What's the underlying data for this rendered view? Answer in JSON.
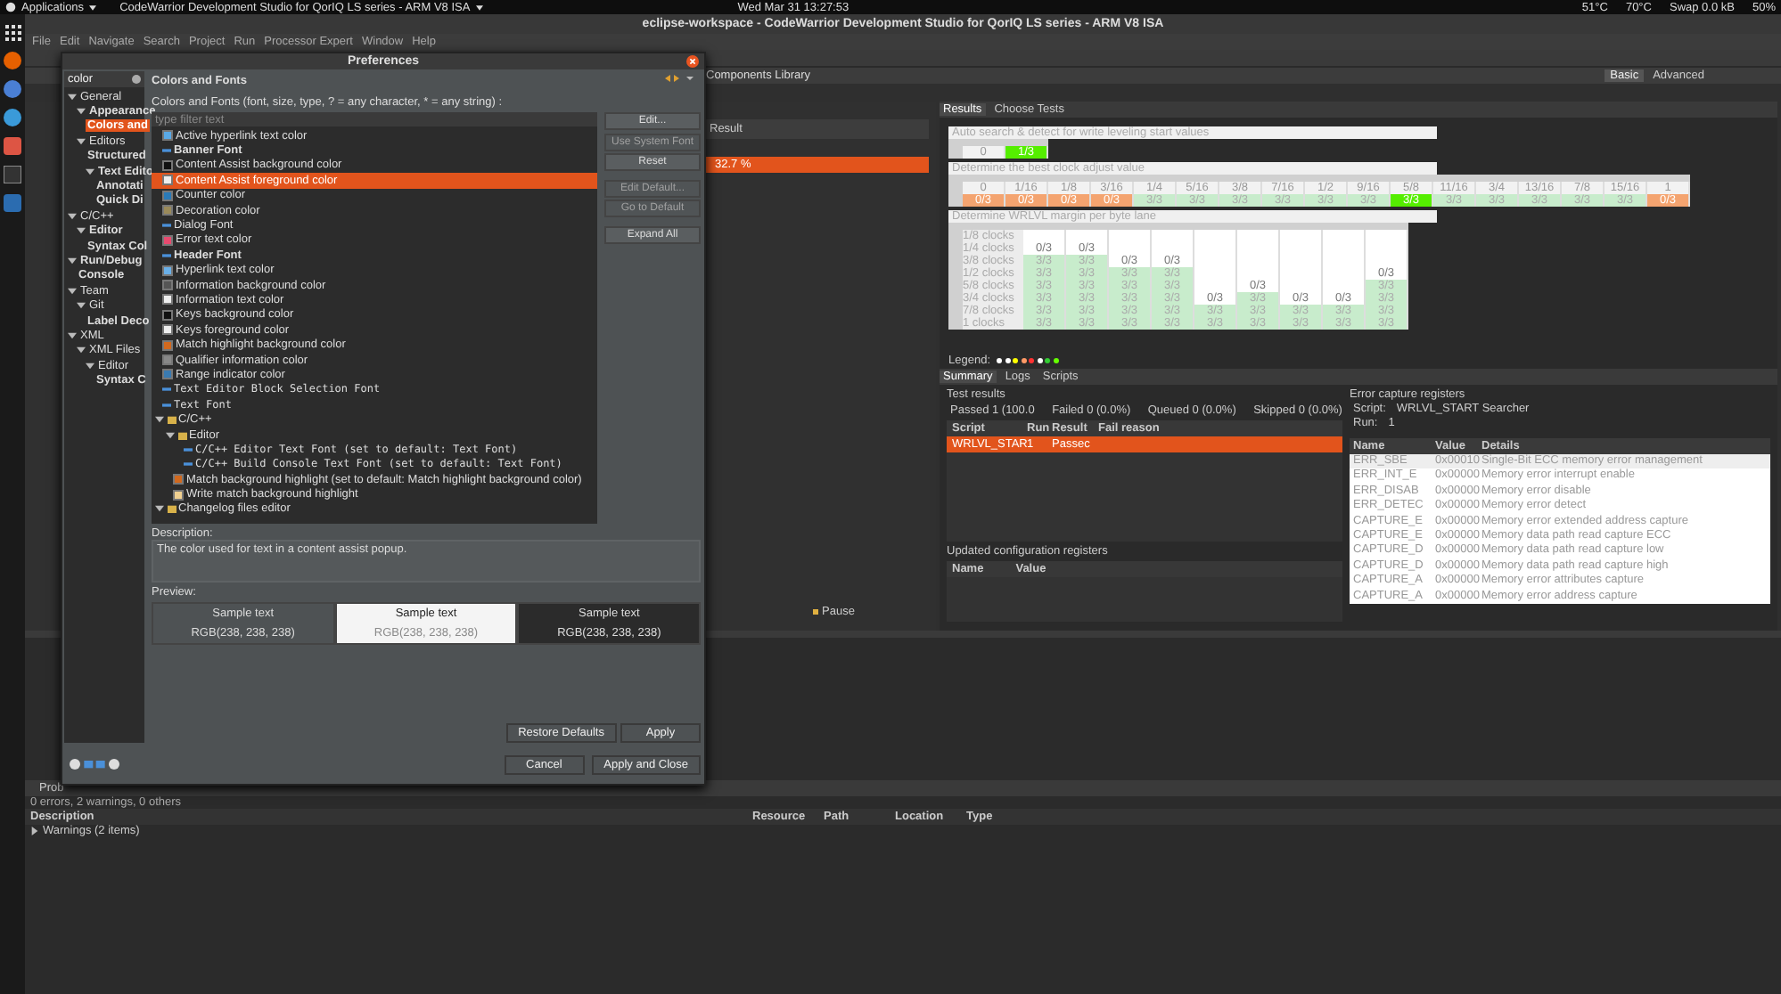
{
  "top_bar": {
    "applications": "Applications",
    "app_menu": "CodeWarrior Development Studio for QorIQ LS series - ARM V8 ISA",
    "clock": "Wed Mar 31  13:27:53",
    "status": [
      "51°C",
      "70°C",
      "Swap 0.0 kB",
      "50%"
    ]
  },
  "window": {
    "title": "eclipse-workspace - CodeWarrior Development Studio for QorIQ LS series - ARM V8 ISA"
  },
  "menu": [
    "File",
    "Edit",
    "Navigate",
    "Search",
    "Project",
    "Run",
    "Processor Expert",
    "Window",
    "Help"
  ],
  "perspective": {
    "tab": "Components Library",
    "buttons": [
      {
        "label": "Basic",
        "selected": true
      },
      {
        "label": "Advanced",
        "selected": false
      }
    ]
  },
  "editor": {
    "column": "Result",
    "value": "32.7 %"
  },
  "results": {
    "tabs": [
      {
        "label": "Results",
        "selected": true
      },
      {
        "label": "Choose Tests",
        "selected": false
      }
    ],
    "tables": [
      {
        "title": "Auto search & detect for write leveling start values",
        "rows": [
          {
            "cells": [
              {
                "text": "0",
                "kind": "plain"
              },
              {
                "text": "1/3",
                "kind": "best"
              }
            ]
          }
        ]
      },
      {
        "title": "Determine the best clock adjust value",
        "header": [
          "0",
          "1/16",
          "1/8",
          "3/16",
          "1/4",
          "5/16",
          "3/8",
          "7/16",
          "1/2",
          "9/16",
          "5/8",
          "11/16",
          "3/4",
          "13/16",
          "7/8",
          "15/16",
          "1"
        ],
        "rows": [
          {
            "cells": [
              {
                "text": "0/3",
                "kind": "fail"
              },
              {
                "text": "0/3",
                "kind": "fail"
              },
              {
                "text": "0/3",
                "kind": "fail"
              },
              {
                "text": "0/3",
                "kind": "fail"
              },
              {
                "text": "3/3",
                "kind": "pass"
              },
              {
                "text": "3/3",
                "kind": "pass"
              },
              {
                "text": "3/3",
                "kind": "pass"
              },
              {
                "text": "3/3",
                "kind": "pass"
              },
              {
                "text": "3/3",
                "kind": "pass"
              },
              {
                "text": "3/3",
                "kind": "pass"
              },
              {
                "text": "3/3",
                "kind": "best"
              },
              {
                "text": "3/3",
                "kind": "pass"
              },
              {
                "text": "3/3",
                "kind": "pass"
              },
              {
                "text": "3/3",
                "kind": "pass"
              },
              {
                "text": "3/3",
                "kind": "pass"
              },
              {
                "text": "3/3",
                "kind": "pass"
              },
              {
                "text": "0/3",
                "kind": "fail"
              }
            ]
          }
        ]
      },
      {
        "title": "Determine WRLVL margin per byte lane",
        "rows": [
          {
            "label": "1/8 clocks",
            "cells": [
              {
                "kind": "empty"
              },
              {
                "kind": "empty"
              },
              {
                "kind": "empty"
              },
              {
                "kind": "empty"
              },
              {
                "kind": "empty"
              },
              {
                "kind": "empty"
              },
              {
                "kind": "empty"
              },
              {
                "kind": "empty"
              },
              {
                "kind": "empty"
              }
            ]
          },
          {
            "label": "1/4 clocks",
            "cells": [
              {
                "text": "0/3",
                "kind": "empty"
              },
              {
                "text": "0/3",
                "kind": "empty"
              },
              {
                "kind": "empty"
              },
              {
                "kind": "empty"
              },
              {
                "kind": "empty"
              },
              {
                "kind": "empty"
              },
              {
                "kind": "empty"
              },
              {
                "kind": "empty"
              },
              {
                "kind": "empty"
              }
            ]
          },
          {
            "label": "3/8 clocks",
            "cells": [
              {
                "text": "3/3",
                "kind": "pass"
              },
              {
                "text": "3/3",
                "kind": "pass"
              },
              {
                "text": "0/3",
                "kind": "empty"
              },
              {
                "text": "0/3",
                "kind": "empty"
              },
              {
                "kind": "empty"
              },
              {
                "kind": "empty"
              },
              {
                "kind": "empty"
              },
              {
                "kind": "empty"
              },
              {
                "kind": "empty"
              }
            ]
          },
          {
            "label": "1/2 clocks",
            "cells": [
              {
                "text": "3/3",
                "kind": "pass"
              },
              {
                "text": "3/3",
                "kind": "pass"
              },
              {
                "text": "3/3",
                "kind": "pass"
              },
              {
                "text": "3/3",
                "kind": "pass"
              },
              {
                "kind": "empty"
              },
              {
                "kind": "empty"
              },
              {
                "kind": "empty"
              },
              {
                "kind": "empty"
              },
              {
                "text": "0/3",
                "kind": "empty"
              }
            ]
          },
          {
            "label": "5/8 clocks",
            "cells": [
              {
                "text": "3/3",
                "kind": "pass"
              },
              {
                "text": "3/3",
                "kind": "pass"
              },
              {
                "text": "3/3",
                "kind": "pass"
              },
              {
                "text": "3/3",
                "kind": "pass"
              },
              {
                "kind": "empty"
              },
              {
                "text": "0/3",
                "kind": "empty"
              },
              {
                "kind": "empty"
              },
              {
                "kind": "empty"
              },
              {
                "text": "3/3",
                "kind": "pass"
              }
            ]
          },
          {
            "label": "3/4 clocks",
            "cells": [
              {
                "text": "3/3",
                "kind": "pass"
              },
              {
                "text": "3/3",
                "kind": "pass"
              },
              {
                "text": "3/3",
                "kind": "pass"
              },
              {
                "text": "3/3",
                "kind": "pass"
              },
              {
                "text": "0/3",
                "kind": "empty"
              },
              {
                "text": "3/3",
                "kind": "pass"
              },
              {
                "text": "0/3",
                "kind": "empty"
              },
              {
                "text": "0/3",
                "kind": "empty"
              },
              {
                "text": "3/3",
                "kind": "pass"
              }
            ]
          },
          {
            "label": "7/8 clocks",
            "cells": [
              {
                "text": "3/3",
                "kind": "pass"
              },
              {
                "text": "3/3",
                "kind": "pass"
              },
              {
                "text": "3/3",
                "kind": "pass"
              },
              {
                "text": "3/3",
                "kind": "pass"
              },
              {
                "text": "3/3",
                "kind": "pass"
              },
              {
                "text": "3/3",
                "kind": "pass"
              },
              {
                "text": "3/3",
                "kind": "pass"
              },
              {
                "text": "3/3",
                "kind": "pass"
              },
              {
                "text": "3/3",
                "kind": "pass"
              }
            ]
          },
          {
            "label": "1 clocks",
            "cells": [
              {
                "text": "3/3",
                "kind": "pass"
              },
              {
                "text": "3/3",
                "kind": "pass"
              },
              {
                "text": "3/3",
                "kind": "pass"
              },
              {
                "text": "3/3",
                "kind": "pass"
              },
              {
                "text": "3/3",
                "kind": "pass"
              },
              {
                "text": "3/3",
                "kind": "pass"
              },
              {
                "text": "3/3",
                "kind": "pass"
              },
              {
                "text": "3/3",
                "kind": "pass"
              },
              {
                "text": "3/3",
                "kind": "pass"
              }
            ]
          }
        ]
      }
    ],
    "legend": {
      "label": "Legend:",
      "items": [
        {
          "color": "#ffffff"
        },
        {
          "color": "#ffffff"
        },
        {
          "color": "#ffff00"
        },
        {
          "color": "#ff9966"
        },
        {
          "color": "#ff3333"
        },
        {
          "color": "#ffffff"
        },
        {
          "color": "#33cc33"
        },
        {
          "color": "#66ff00"
        }
      ]
    }
  },
  "summary": {
    "tabs": [
      {
        "label": "Summary",
        "selected": true
      },
      {
        "label": "Logs",
        "selected": false
      },
      {
        "label": "Scripts",
        "selected": false
      }
    ],
    "test_results": {
      "title": "Test results",
      "counts": [
        "Passed 1 (100.0",
        "Failed 0 (0.0%)",
        "Queued 0 (0.0%)",
        "Skipped 0 (0.0%)"
      ],
      "columns": [
        "Script",
        "Run",
        "Result",
        "Fail reason"
      ],
      "rows": [
        {
          "cells": [
            "WRLVL_STAR",
            "1",
            "Passec",
            ""
          ],
          "selected": true
        }
      ]
    },
    "updated": {
      "title": "Updated configuration registers",
      "columns": [
        "Name",
        "Value"
      ]
    },
    "pause": "Pause",
    "error_capture": {
      "title": "Error capture registers",
      "script_label": "Script:",
      "script": "WRLVL_START Searcher",
      "run_label": "Run:",
      "run": "1",
      "columns": [
        "Name",
        "Value",
        "Details"
      ],
      "rows": [
        {
          "name": "ERR_SBE",
          "value": "0x00010",
          "details": "Single-Bit ECC memory error management",
          "selected": true
        },
        {
          "name": "ERR_INT_E",
          "value": "0x00000",
          "details": "Memory error interrupt enable",
          "selected": false
        },
        {
          "name": "ERR_DISAB",
          "value": "0x00000",
          "details": "Memory error disable",
          "selected": false
        },
        {
          "name": "ERR_DETEC",
          "value": "0x00000",
          "details": "Memory error detect",
          "selected": false
        },
        {
          "name": "CAPTURE_E",
          "value": "0x00000",
          "details": "Memory error extended address capture",
          "selected": false
        },
        {
          "name": "CAPTURE_E",
          "value": "0x00000",
          "details": "Memory data path read capture ECC",
          "selected": false
        },
        {
          "name": "CAPTURE_D",
          "value": "0x00000",
          "details": "Memory data path read capture low",
          "selected": false
        },
        {
          "name": "CAPTURE_D",
          "value": "0x00000",
          "details": "Memory data path read capture high",
          "selected": false
        },
        {
          "name": "CAPTURE_A",
          "value": "0x00000",
          "details": "Memory error attributes capture",
          "selected": false
        },
        {
          "name": "CAPTURE_A",
          "value": "0x00000",
          "details": "Memory error address capture",
          "selected": false
        }
      ]
    }
  },
  "problems": {
    "tab": "Prob",
    "summary": "0 errors, 2 warnings, 0 others",
    "columns": [
      "Description",
      "Resource",
      "Path",
      "Location",
      "Type"
    ],
    "rows": [
      {
        "label": "Warnings (2 items)",
        "expanded": false
      }
    ]
  },
  "preferences": {
    "title": "Preferences",
    "filter": "color",
    "tree": [
      {
        "label": "General",
        "matched": false,
        "selected": false,
        "expanded": true,
        "children": [
          {
            "label": "Appearance",
            "matched": true,
            "selected": false,
            "expanded": true,
            "children": [
              {
                "label": "Colors and",
                "matched": true,
                "selected": true
              }
            ]
          },
          {
            "label": "Editors",
            "matched": false,
            "selected": false,
            "expanded": true,
            "children": [
              {
                "label": "Structured",
                "matched": true,
                "selected": false
              },
              {
                "label": "Text Edito",
                "matched": true,
                "selected": false,
                "expanded": true,
                "children": [
                  {
                    "label": "Annotati",
                    "matched": true,
                    "selected": false
                  },
                  {
                    "label": "Quick Di",
                    "matched": true,
                    "selected": false
                  }
                ]
              }
            ]
          }
        ]
      },
      {
        "label": "C/C++",
        "matched": false,
        "selected": false,
        "expanded": true,
        "children": [
          {
            "label": "Editor",
            "matched": true,
            "selected": false,
            "expanded": true,
            "children": [
              {
                "label": "Syntax Col",
                "matched": true,
                "selected": false
              }
            ]
          }
        ]
      },
      {
        "label": "Run/Debug",
        "matched": true,
        "selected": false,
        "expanded": true,
        "children": [
          {
            "label": "Console",
            "matched": true,
            "selected": false
          }
        ]
      },
      {
        "label": "Team",
        "matched": false,
        "selected": false,
        "expanded": true,
        "children": [
          {
            "label": "Git",
            "matched": false,
            "selected": false,
            "expanded": true,
            "children": [
              {
                "label": "Label Deco",
                "matched": true,
                "selected": false
              }
            ]
          }
        ]
      },
      {
        "label": "XML",
        "matched": false,
        "selected": false,
        "expanded": true,
        "children": [
          {
            "label": "XML Files",
            "matched": false,
            "selected": false,
            "expanded": true,
            "children": [
              {
                "label": "Editor",
                "matched": false,
                "selected": false,
                "expanded": true,
                "children": [
                  {
                    "label": "Syntax C",
                    "matched": true,
                    "selected": false
                  }
                ]
              }
            ]
          }
        ]
      }
    ],
    "page_title": "Colors and Fonts",
    "prompt": "Colors and Fonts (font, size, type, ? = any character, * = any string) :",
    "filter_placeholder": "type filter text",
    "items": [
      {
        "label": "Active hyperlink text color",
        "kind": "color",
        "color": "#5aa9e6",
        "selected": false
      },
      {
        "label": "Banner Font",
        "kind": "boldfont",
        "selected": false
      },
      {
        "label": "Content Assist background color",
        "kind": "color",
        "color": "#111111",
        "selected": false
      },
      {
        "label": "Content Assist foreground color",
        "kind": "color",
        "color": "#eeeeee",
        "selected": true
      },
      {
        "label": "Counter color",
        "kind": "color",
        "color": "#2a7ab8",
        "selected": false
      },
      {
        "label": "Decoration color",
        "kind": "color",
        "color": "#9a8a5a",
        "selected": false
      },
      {
        "label": "Dialog Font",
        "kind": "font",
        "selected": false
      },
      {
        "label": "Error text color",
        "kind": "color",
        "color": "#e84a6f",
        "selected": false
      },
      {
        "label": "Header Font",
        "kind": "boldfont",
        "selected": false
      },
      {
        "label": "Hyperlink text color",
        "kind": "color",
        "color": "#6ab0e8",
        "selected": false
      },
      {
        "label": "Information background color",
        "kind": "color",
        "color": "#555555",
        "selected": false
      },
      {
        "label": "Information text color",
        "kind": "color",
        "color": "#eeeeee",
        "selected": false
      },
      {
        "label": "Keys background color",
        "kind": "color",
        "color": "#111111",
        "selected": false
      },
      {
        "label": "Keys foreground color",
        "kind": "color",
        "color": "#eeeeee",
        "selected": false
      },
      {
        "label": "Match highlight background color",
        "kind": "color",
        "color": "#d2691e",
        "selected": false
      },
      {
        "label": "Qualifier information color",
        "kind": "color",
        "color": "#888888",
        "selected": false
      },
      {
        "label": "Range indicator color",
        "kind": "color",
        "color": "#3a7ab0",
        "selected": false
      },
      {
        "label": "Text Editor Block Selection Font",
        "kind": "monofont",
        "selected": false
      },
      {
        "label": "Text Font",
        "kind": "monofont",
        "selected": false
      },
      {
        "label": "C/C++",
        "kind": "group",
        "expanded": true,
        "children": [
          {
            "label": "Editor",
            "kind": "group",
            "expanded": true,
            "children": [
              {
                "label": "C/C++ Editor Text Font (set to default: Text Font)",
                "kind": "monofont",
                "selected": false
              },
              {
                "label": "C/C++ Build Console Text Font (set to default: Text Font)",
                "kind": "monofont",
                "selected": false
              }
            ]
          },
          {
            "label": "Match background highlight (set to default: Match highlight background color)",
            "kind": "color",
            "color": "#d2691e",
            "selected": false
          },
          {
            "label": "Write match background highlight",
            "kind": "color",
            "color": "#f0d090",
            "selected": false
          }
        ]
      },
      {
        "label": "Changelog files editor",
        "kind": "group",
        "expanded": true
      }
    ],
    "side_buttons": [
      {
        "label": "Edit...",
        "disabled": false
      },
      {
        "label": "Use System Font",
        "disabled": true
      },
      {
        "label": "Reset",
        "disabled": false
      },
      {
        "label": "Edit Default...",
        "disabled": true
      },
      {
        "label": "Go to Default",
        "disabled": true
      },
      {
        "label": "Expand All",
        "disabled": false
      }
    ],
    "description_label": "Description:",
    "description": "The color used for text in a content assist popup.",
    "preview_label": "Preview:",
    "preview": [
      {
        "sample": "Sample text",
        "rgb": "RGB(238, 238, 238)",
        "kind": "default"
      },
      {
        "sample": "Sample text",
        "rgb": "RGB(238, 238, 238)",
        "kind": "light"
      },
      {
        "sample": "Sample text",
        "rgb": "RGB(238, 238, 238)",
        "kind": "dark"
      }
    ],
    "buttons": [
      "Restore Defaults",
      "Apply"
    ],
    "footer_buttons": [
      "Cancel",
      "Apply and Close"
    ]
  }
}
